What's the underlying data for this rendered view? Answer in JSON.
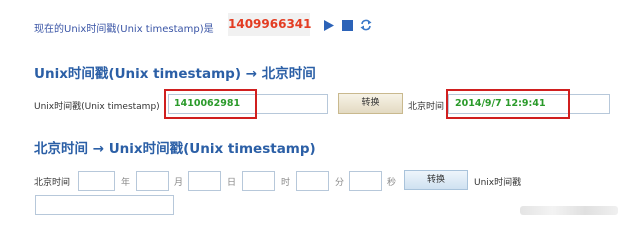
{
  "current": {
    "label": "现在的Unix时间戳(Unix timestamp)是",
    "value": "1409966341",
    "icons": [
      "play-icon",
      "stop-icon",
      "refresh-icon"
    ],
    "value_color": "#e33c22"
  },
  "section1": {
    "heading": "Unix时间戳(Unix timestamp) → 北京时间",
    "ts_label": "Unix时间戳(Unix timestamp)",
    "ts_value": "1410062981",
    "convert_label": "转换",
    "beijing_label": "北京时间",
    "beijing_value": "2014/9/7 12:9:41"
  },
  "section2": {
    "heading": "北京时间 → Unix时间戳(Unix timestamp)",
    "beijing_label": "北京时间",
    "year_label": "年",
    "month_label": "月",
    "day_label": "日",
    "hour_label": "时",
    "minute_label": "分",
    "second_label": "秒",
    "convert_label": "转换",
    "unix_label": "Unix时间戳"
  },
  "colors": {
    "heading": "#2b5fa6",
    "highlight": "#d01f1f",
    "value_green": "#2a9a2a"
  }
}
